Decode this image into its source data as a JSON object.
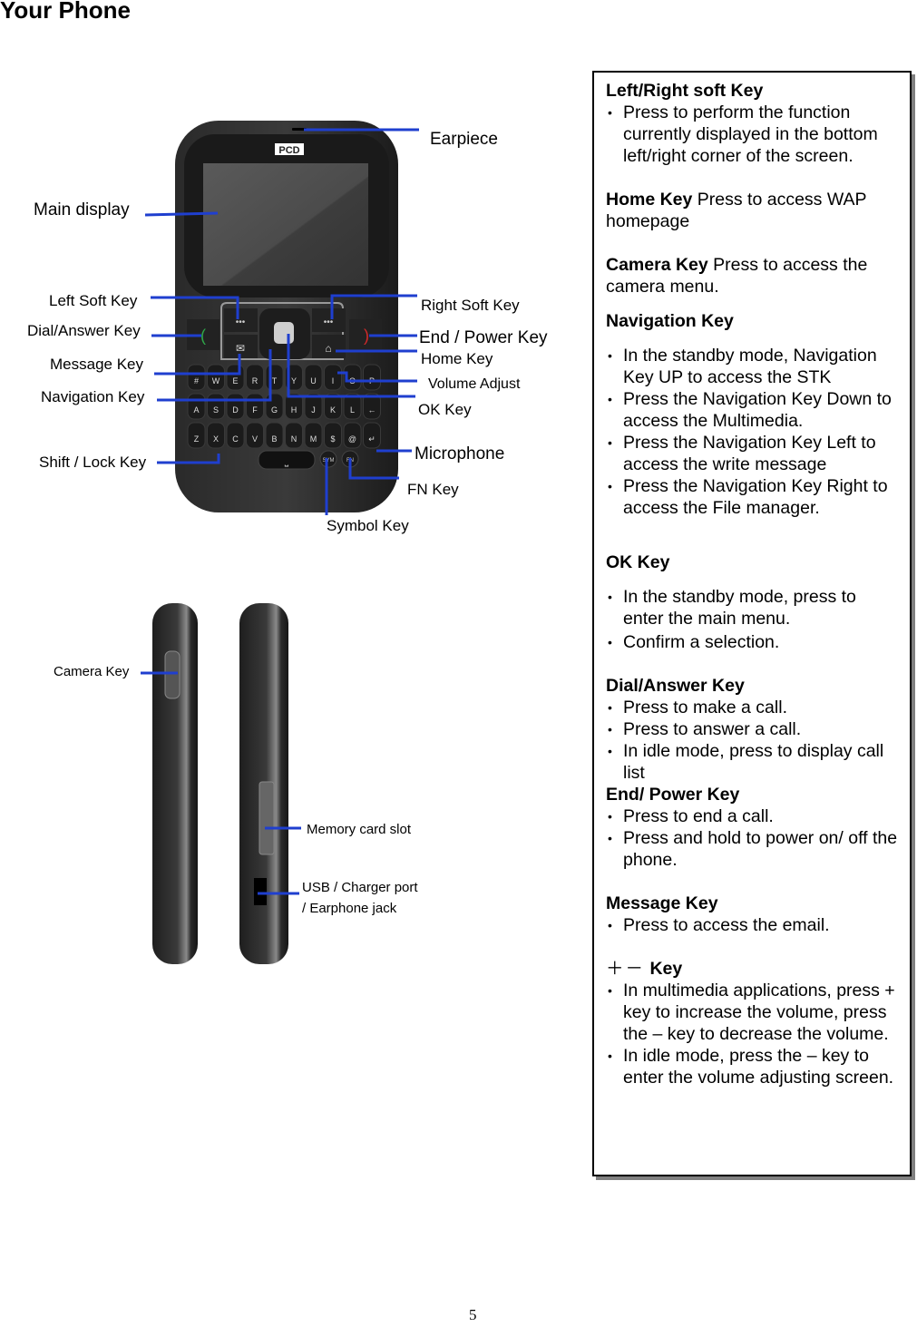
{
  "page": {
    "title": "Your Phone",
    "page_number": "5"
  },
  "front_view": {
    "brand_logo": "PCD",
    "callouts": {
      "earpiece": "Earpiece",
      "main_display": "Main display",
      "left_soft_key": "Left Soft Key",
      "right_soft_key": "Right Soft Key",
      "dial_answer_key": "Dial/Answer Key",
      "end_power_key": "End / Power Key",
      "home_key": "Home Key",
      "message_key": "Message Key",
      "volume_adjust": "Volume Adjust",
      "navigation_key": "Navigation Key",
      "ok_key": "OK Key",
      "microphone": "Microphone",
      "shift_lock_key": "Shift / Lock Key",
      "fn_key": "FN Key",
      "symbol_key": "Symbol Key"
    },
    "keyboard_rows": [
      [
        "#",
        "W",
        "E",
        "R",
        "T",
        "Y",
        "U",
        "I",
        "O",
        "P"
      ],
      [
        "A",
        "S",
        "D",
        "F",
        "G",
        "H",
        "J",
        "K",
        "L",
        "←"
      ],
      [
        "Z",
        "X",
        "C",
        "V",
        "B",
        "N",
        "M",
        "$",
        "@",
        "↵"
      ]
    ],
    "bottom_keys": {
      "sym": "SYM",
      "fn": "FN"
    },
    "accent_colors": {
      "callout_line": "#1f3fcf",
      "dial_key": "#2fa84a",
      "end_key": "#d22a2a",
      "key_digit": "#d2772a"
    }
  },
  "side_view": {
    "callouts": {
      "camera_key": "Camera Key",
      "memory_card_slot": "Memory card slot",
      "usb_port_line1": "USB / Charger port",
      "usb_port_line2": "/ Earphone jack"
    }
  },
  "info_box": {
    "soft_key": {
      "heading": "Left/Right soft Key",
      "bullets": [
        "Press to perform the function currently displayed in the bottom left/right corner of the screen."
      ]
    },
    "home_key": {
      "heading": "Home Key",
      "text": " Press to access WAP homepage"
    },
    "camera_key": {
      "heading": "Camera Key",
      "text": " Press to access the camera menu."
    },
    "navigation_key": {
      "heading": "Navigation Key",
      "bullets": [
        "In the standby mode,  Navigation Key UP to access the STK",
        "Press the Navigation Key Down to access the Multimedia.",
        "Press the Navigation Key Left to access the write message",
        "Press the Navigation Key Right to access the File manager."
      ]
    },
    "ok_key": {
      "heading": "OK Key",
      "bullets": [
        "In the standby mode, press to enter the main menu.",
        "Confirm a selection."
      ]
    },
    "dial_answer_key": {
      "heading": "Dial/Answer Key",
      "bullets": [
        "Press to make a call.",
        "Press to answer a call.",
        "In idle mode, press to display call list"
      ]
    },
    "end_power_key": {
      "heading": "End/ Power Key",
      "bullets": [
        "Press to end a call.",
        "Press and hold to power on/ off the phone."
      ]
    },
    "message_key": {
      "heading": "Message Key",
      "bullets": [
        "Press to access the email."
      ]
    },
    "volume_key": {
      "symbol": "＋－",
      "heading": "Key",
      "bullets": [
        "In multimedia applications, press + key to increase the volume, press the – key to decrease the volume.",
        "In idle mode, press the – key to enter the volume adjusting screen."
      ]
    }
  }
}
